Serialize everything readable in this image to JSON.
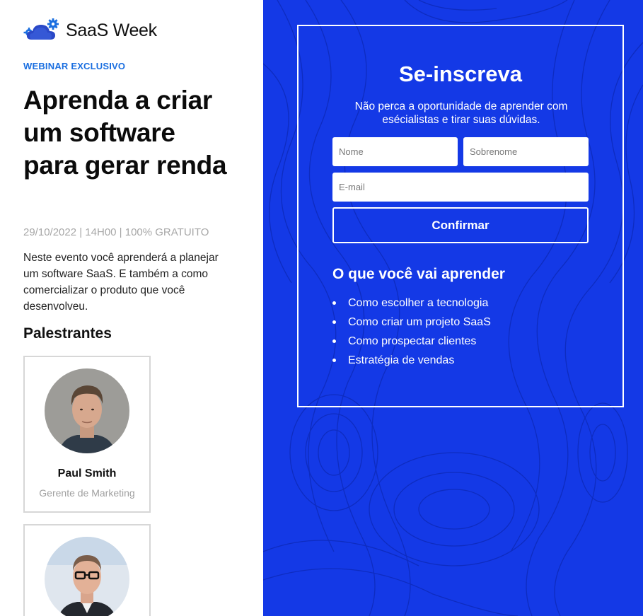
{
  "brand": {
    "name": "SaaS Week",
    "icon": "cloud-gear-icon"
  },
  "hero": {
    "eyebrow": "WEBINAR EXCLUSIVO",
    "headline": "Aprenda a criar um software para gerar renda",
    "meta": "29/10/2022 | 14H00 | 100% GRATUITO",
    "description": "Neste evento você aprenderá a planejar um software SaaS. E também a como comercializar o produto que você desenvolveu."
  },
  "speakers": {
    "title": "Palestrantes",
    "items": [
      {
        "name": "Paul Smith",
        "role": "Gerente de Marketing"
      },
      {
        "name": "",
        "role": ""
      }
    ]
  },
  "signup": {
    "title": "Se-inscreva",
    "subtitle": "Não perca a oportunidade de aprender com esécialistas e tirar suas dúvidas.",
    "first_name_placeholder": "Nome",
    "last_name_placeholder": "Sobrenome",
    "email_placeholder": "E-mail",
    "confirm_label": "Confirmar"
  },
  "learn": {
    "title": "O que você vai aprender",
    "items": [
      "Como escolher a tecnologia",
      "Como criar um projeto SaaS",
      "Como prospectar clientes",
      "Estratégia de vendas"
    ]
  },
  "colors": {
    "accent": "#1b6fe0",
    "panel": "#1439e6",
    "muted": "#a7a7a7"
  }
}
